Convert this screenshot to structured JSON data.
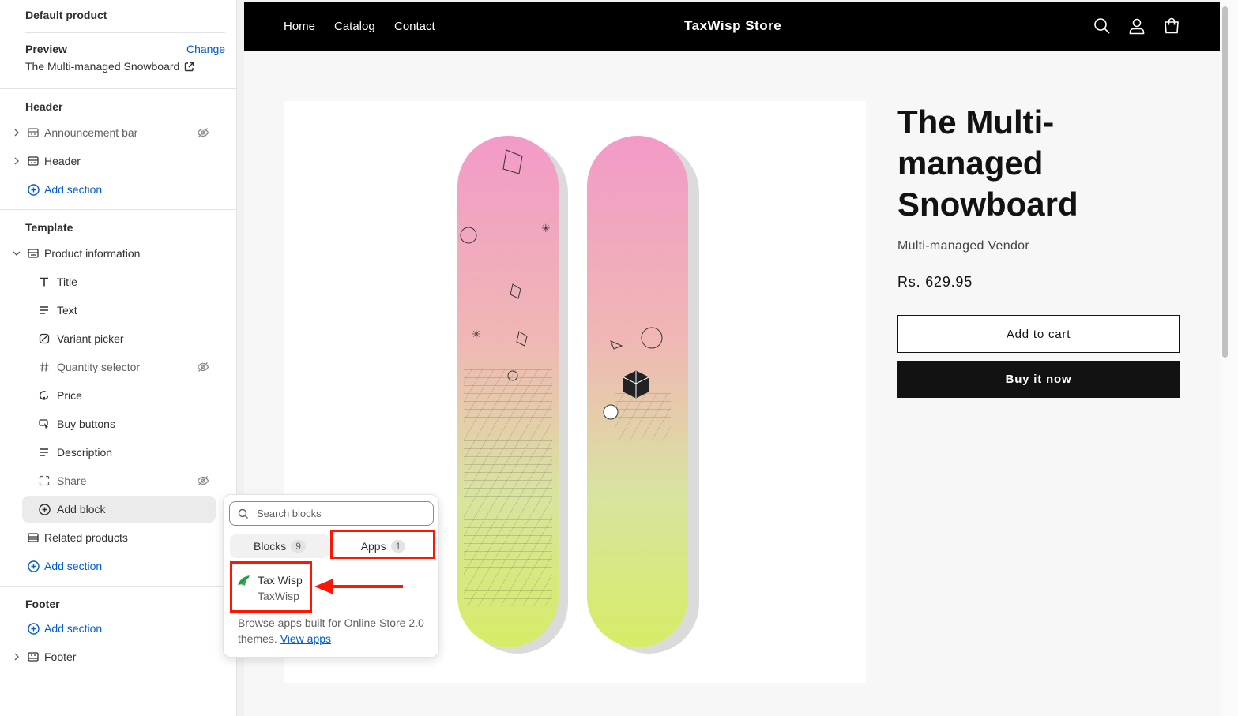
{
  "sidebar": {
    "title": "Default product",
    "preview_label": "Preview",
    "change_label": "Change",
    "preview_product": "The Multi-managed Snowboard",
    "header_group": {
      "title": "Header",
      "items": [
        {
          "label": "Announcement bar",
          "icon": "section-icon",
          "hidden": true
        },
        {
          "label": "Header",
          "icon": "section-icon",
          "hidden": false
        }
      ],
      "add_section": "Add section"
    },
    "template_group": {
      "title": "Template",
      "section": "Product information",
      "blocks": [
        {
          "label": "Title",
          "icon": "title-icon",
          "hidden": false
        },
        {
          "label": "Text",
          "icon": "text-icon",
          "hidden": false
        },
        {
          "label": "Variant picker",
          "icon": "variant-icon",
          "hidden": false
        },
        {
          "label": "Quantity selector",
          "icon": "hash-icon",
          "hidden": true
        },
        {
          "label": "Price",
          "icon": "price-tag-icon",
          "hidden": false
        },
        {
          "label": "Buy buttons",
          "icon": "cursor-icon",
          "hidden": false
        },
        {
          "label": "Description",
          "icon": "text-icon",
          "hidden": false
        },
        {
          "label": "Share",
          "icon": "share-icon",
          "hidden": true
        }
      ],
      "add_block": "Add block",
      "related": "Related products",
      "add_section": "Add section"
    },
    "footer_group": {
      "title": "Footer",
      "add_section": "Add section",
      "footer": "Footer"
    }
  },
  "popover": {
    "search_placeholder": "Search blocks",
    "tabs": [
      {
        "label": "Blocks",
        "count": "9"
      },
      {
        "label": "Apps",
        "count": "1"
      }
    ],
    "app": {
      "name": "Tax Wisp",
      "developer": "TaxWisp"
    },
    "browse_text": "Browse apps built for Online Store 2.0 themes.",
    "view_apps": "View apps",
    "highlight_color": "#ff1500"
  },
  "store": {
    "nav": [
      "Home",
      "Catalog",
      "Contact"
    ],
    "brand": "TaxWisp Store",
    "product_title": "The Multi-managed Snowboard",
    "vendor": "Multi-managed Vendor",
    "price": "Rs. 629.95",
    "add_to_cart": "Add to cart",
    "buy_now": "Buy it now",
    "header_icons": [
      "search-icon",
      "account-icon",
      "cart-icon"
    ]
  },
  "colors": {
    "accent": "#005bd3",
    "store_header": "#000000",
    "buy_button": "#121212"
  }
}
